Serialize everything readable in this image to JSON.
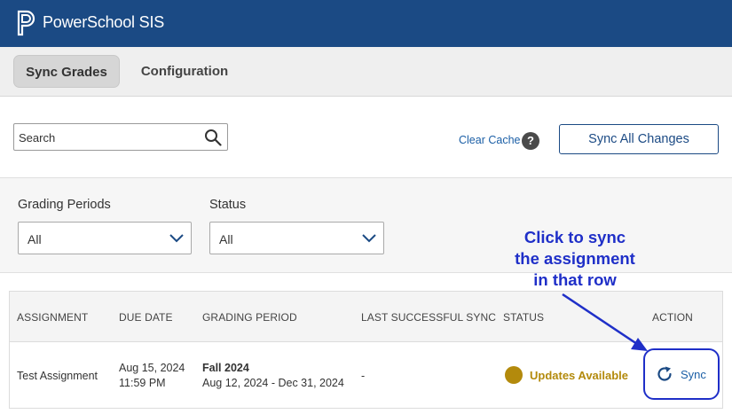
{
  "header": {
    "app_title": "PowerSchool SIS",
    "bg_color": "#1b4a84"
  },
  "tabs": [
    {
      "label": "Sync Grades",
      "active": true
    },
    {
      "label": "Configuration",
      "active": false
    }
  ],
  "toolbar": {
    "search_placeholder": "Search",
    "clear_cache_label": "Clear Cache",
    "help_glyph": "?",
    "sync_all_label": "Sync All Changes"
  },
  "filters": {
    "grading_periods": {
      "label": "Grading Periods",
      "value": "All"
    },
    "status": {
      "label": "Status",
      "value": "All"
    }
  },
  "table": {
    "headers": [
      "ASSIGNMENT",
      "DUE DATE",
      "GRADING PERIOD",
      "LAST SUCCESSFUL SYNC",
      "STATUS",
      "ACTION"
    ],
    "rows": [
      {
        "assignment": "Test Assignment",
        "due_date": "Aug 15, 2024",
        "due_time": "11:59 PM",
        "grading_period": "Fall 2024",
        "grading_range": "Aug 12, 2024 - Dec 31, 2024",
        "last_sync": "-",
        "status": "Updates Available",
        "status_color": "#b38a0c",
        "action": "Sync"
      }
    ]
  },
  "annotation": {
    "line1": "Click to sync",
    "line2": "the assignment",
    "line3": "in that row",
    "color": "#1f2fc8"
  }
}
